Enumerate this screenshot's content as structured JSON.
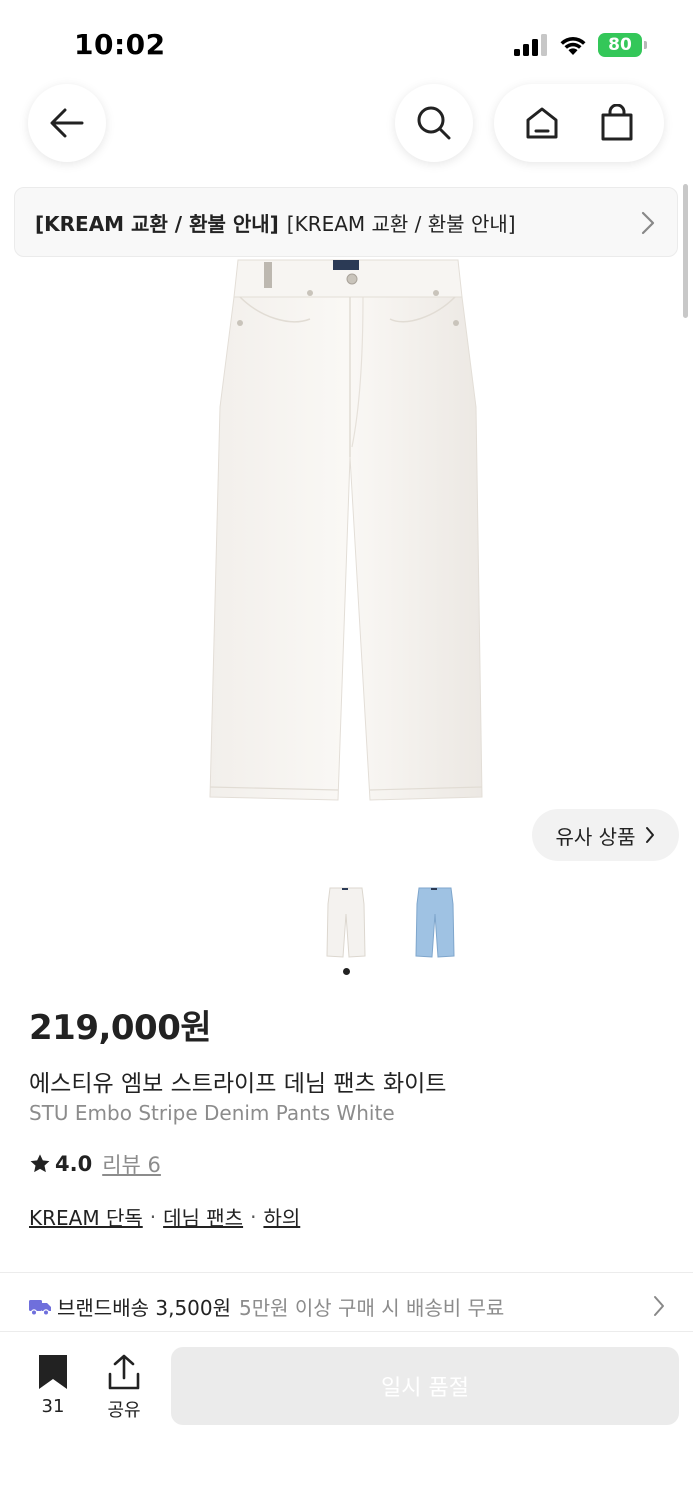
{
  "status_bar": {
    "time": "10:02",
    "battery": "80"
  },
  "nav": {
    "back_icon": "arrow-left-icon",
    "search_icon": "search-icon",
    "home_icon": "home-icon",
    "cart_icon": "shopping-bag-icon"
  },
  "notice": {
    "bold_text": "[KREAM 교환 / 환불 안내]",
    "text": "[KREAM 교환 / 환불 안내]"
  },
  "product": {
    "image_alt": "white denim pants",
    "similar_label": "유사 상품",
    "thumbnails": [
      "white",
      "light-blue"
    ],
    "price": "219,000원",
    "name_ko": "에스티유 엠보 스트라이프 데님 팬츠 화이트",
    "name_en": "STU Embo Stripe Denim Pants White",
    "rating": "4.0",
    "review_label": "리뷰 6",
    "tags": [
      "KREAM 단독",
      "데님 팬츠",
      "하의"
    ],
    "tag_separator": "·"
  },
  "shipping": {
    "label": "브랜드배송 3,500원",
    "note": "5만원 이상 구매 시 배송비 무료"
  },
  "bottom_bar": {
    "bookmark_count": "31",
    "share_label": "공유",
    "soldout_label": "일시 품절"
  },
  "colors": {
    "accent_truck": "#6f6fdc",
    "battery_green": "#34c759",
    "disabled_button": "#ebebeb"
  }
}
